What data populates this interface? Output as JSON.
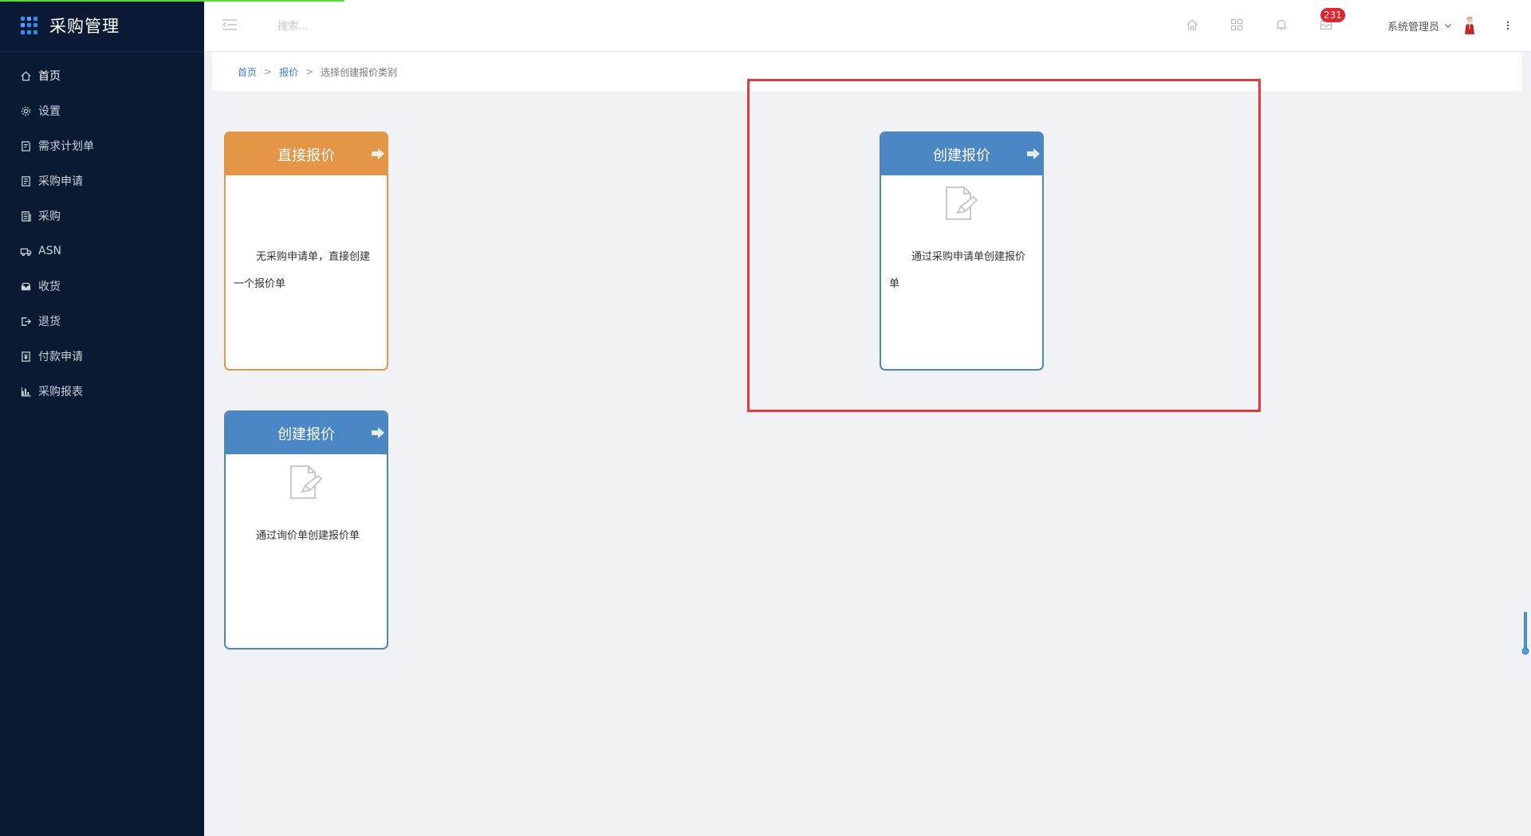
{
  "app": {
    "title": "采购管理"
  },
  "sidebar": {
    "items": [
      {
        "label": "首页",
        "icon": "home-icon"
      },
      {
        "label": "设置",
        "icon": "gear-icon"
      },
      {
        "label": "需求计划单",
        "icon": "note-icon"
      },
      {
        "label": "采购申请",
        "icon": "form-icon"
      },
      {
        "label": "采购",
        "icon": "list-icon"
      },
      {
        "label": "ASN",
        "icon": "truck-icon"
      },
      {
        "label": "收货",
        "icon": "inbox-icon"
      },
      {
        "label": "退货",
        "icon": "exit-icon"
      },
      {
        "label": "付款申请",
        "icon": "payment-icon"
      },
      {
        "label": "采购报表",
        "icon": "bar-chart-icon"
      }
    ]
  },
  "header": {
    "search_placeholder": "搜索...",
    "badge_count": "231",
    "user_name": "系统管理员"
  },
  "breadcrumb": {
    "home": "首页",
    "parent": "报价",
    "separator": ">",
    "current": "选择创建报价类别"
  },
  "cards": {
    "direct": {
      "title": "直接报价",
      "text": "无采购申请单，直接创建一个报价单"
    },
    "from_request": {
      "title": "创建报价",
      "text": "通过采购申请单创建报价单"
    },
    "from_inquiry": {
      "title": "创建报价",
      "text": "通过询价单创建报价单"
    }
  },
  "colors": {
    "sidebar_bg": "#0b1a33",
    "orange": "#e49545",
    "blue": "#4a87c4",
    "badge": "#e4232a",
    "highlight": "#e23b3b"
  }
}
